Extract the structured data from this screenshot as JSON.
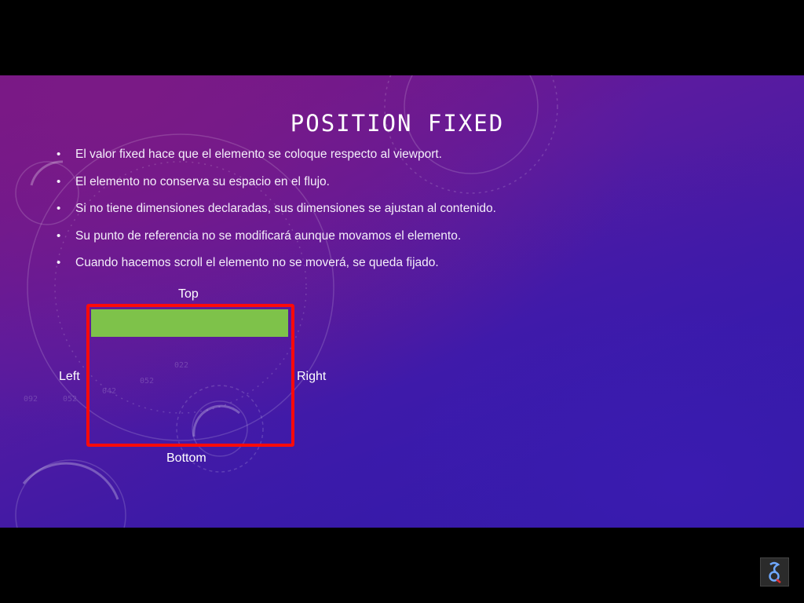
{
  "slide": {
    "title": "POSITION FIXED",
    "bullets": [
      "El valor fixed hace que el elemento se coloque respecto al viewport.",
      "El elemento no conserva su espacio en el flujo.",
      "Si no tiene dimensiones declaradas, sus dimensiones se ajustan al contenido.",
      "Su punto de referencia no se modificará aunque movamos el elemento.",
      "Cuando hacemos scroll el elemento no se moverá, se queda fijado."
    ],
    "bullet_glyph": "•"
  },
  "diagram": {
    "top_label": "Top",
    "left_label": "Left",
    "right_label": "Right",
    "bottom_label": "Bottom",
    "frame_color": "#ff0a0a",
    "element_color": "#7ec24a"
  },
  "colors": {
    "background_start": "#7d1582",
    "background_end": "#2b1a9c",
    "letterbox": "#000000"
  },
  "icons": {
    "channel_logo": "channel-logo-icon"
  }
}
